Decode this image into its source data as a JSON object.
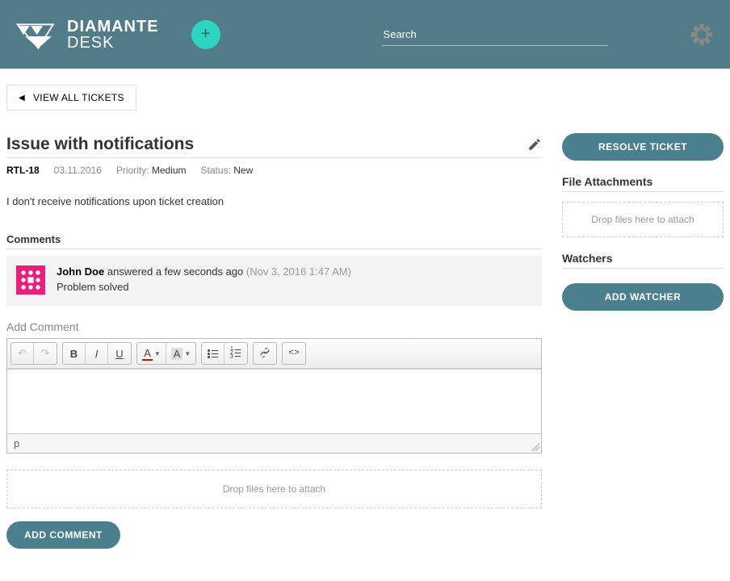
{
  "header": {
    "brand_line1": "DIAMANTE",
    "brand_line2": "DESK",
    "search_placeholder": "Search"
  },
  "nav": {
    "back_label": "VIEW ALL TICKETS"
  },
  "ticket": {
    "title": "Issue with notifications",
    "id": "RTL-18",
    "date": "03.11.2016",
    "priority_label": "Priority:",
    "priority_value": "Medium",
    "status_label": "Status:",
    "status_value": "New",
    "description": "I don't receive notifications upon ticket creation"
  },
  "comments": {
    "heading": "Comments",
    "items": [
      {
        "author": "John Doe",
        "action": "answered a few seconds ago",
        "timestamp": "(Nov 3, 2016 1:47 AM)",
        "text": "Problem solved"
      }
    ],
    "add_label": "Add Comment",
    "path_indicator": "p",
    "dropzone_text": "Drop files here to attach",
    "submit_label": "ADD COMMENT"
  },
  "sidebar": {
    "resolve_label": "RESOLVE TICKET",
    "attachments_heading": "File Attachments",
    "attachments_drop": "Drop files here to attach",
    "watchers_heading": "Watchers",
    "add_watcher_label": "ADD WATCHER"
  }
}
